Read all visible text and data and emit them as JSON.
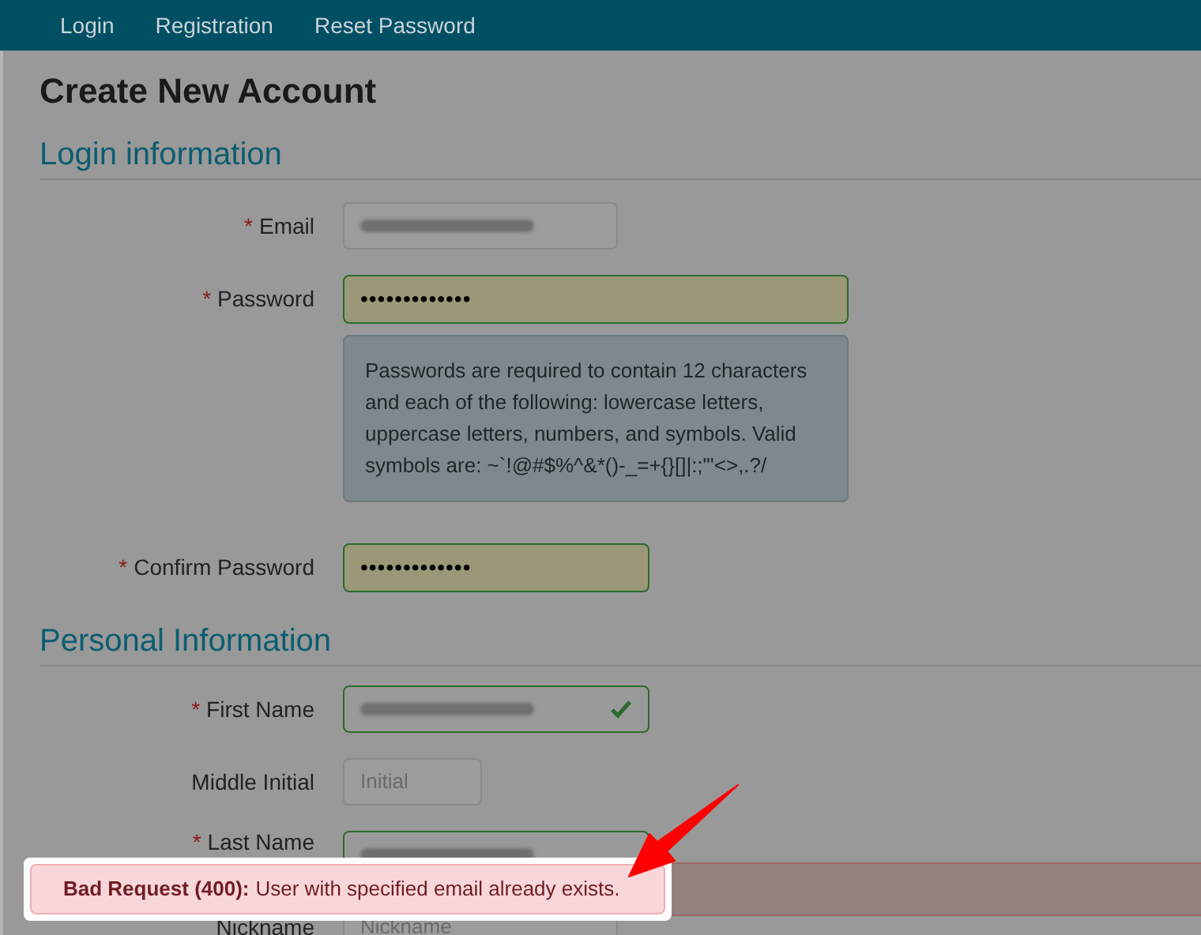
{
  "nav": [
    {
      "label": "Login"
    },
    {
      "label": "Registration"
    },
    {
      "label": "Reset Password"
    }
  ],
  "title": "Create New Account",
  "sections": [
    {
      "title": "Login information",
      "fields": [
        {
          "mark": "*",
          "label": "Email",
          "kind": "redacted",
          "valid": false,
          "check": false
        },
        {
          "mark": "*",
          "label": "Password",
          "kind": "masked",
          "value": "•••••••••••••",
          "valid": true,
          "check": false,
          "hint": "Passwords are required to contain 12 characters and each of the following: lowercase letters, uppercase letters, numbers, and symbols. Valid symbols are: ~`!@#$%^&*()-_=+{}[]|:;\"'<>,.?/"
        },
        {
          "mark": "*",
          "label": "Confirm Password",
          "kind": "masked",
          "value": "•••••••••••••",
          "valid": true,
          "check": false
        }
      ]
    },
    {
      "title": "Personal Information",
      "fields": [
        {
          "mark": "*",
          "label": "First Name",
          "kind": "redacted",
          "valid": true,
          "check": true
        },
        {
          "label": "Middle Initial",
          "kind": "placeholder",
          "placeholder": "Initial",
          "valid": false,
          "check": false
        },
        {
          "mark": "*",
          "label": "Last Name",
          "kind": "redacted",
          "valid": true,
          "check": false
        },
        {
          "label": "Nickname",
          "kind": "placeholder",
          "placeholder": "Nickname",
          "valid": false,
          "check": false
        }
      ]
    }
  ],
  "alert": {
    "title": "Bad Request (400):",
    "message": "User with specified email already exists."
  }
}
